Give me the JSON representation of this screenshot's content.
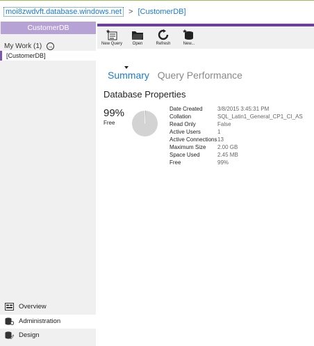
{
  "breadcrumb": {
    "server": "moi8zwdvft.database.windows.net",
    "separator": ">",
    "database": "[CustomerDB]"
  },
  "sidebar": {
    "header": "CustomerDB",
    "my_work_label": "My Work (1)",
    "my_work_item": "[CustomerDB]",
    "nav": [
      {
        "label": "Overview"
      },
      {
        "label": "Administration"
      },
      {
        "label": "Design"
      }
    ]
  },
  "toolbar": {
    "new_query": "New Query",
    "open": "Open",
    "refresh": "Refresh",
    "new": "New..."
  },
  "tabs": {
    "summary": "Summary",
    "query_performance": "Query Performance"
  },
  "main": {
    "section_title": "Database Properties",
    "free_percent": "99%",
    "free_label": "Free",
    "pie_free_fraction": 0.99,
    "properties": [
      {
        "key": "Date Created",
        "value": "3/8/2015 3:45:31 PM"
      },
      {
        "key": "Collation",
        "value": "SQL_Latin1_General_CP1_CI_AS"
      },
      {
        "key": "Read Only",
        "value": "False"
      },
      {
        "key": "Active Users",
        "value": "1"
      },
      {
        "key": "Active Connections",
        "value": "13"
      },
      {
        "key": "Maximum Size",
        "value": "2.00 GB"
      },
      {
        "key": "Space Used",
        "value": "2.45 MB"
      },
      {
        "key": "Free",
        "value": "99%"
      }
    ]
  },
  "colors": {
    "accent_purple": "#6b3fa0",
    "header_lavender": "#b7a2d6",
    "link_blue": "#1b7bd0"
  }
}
